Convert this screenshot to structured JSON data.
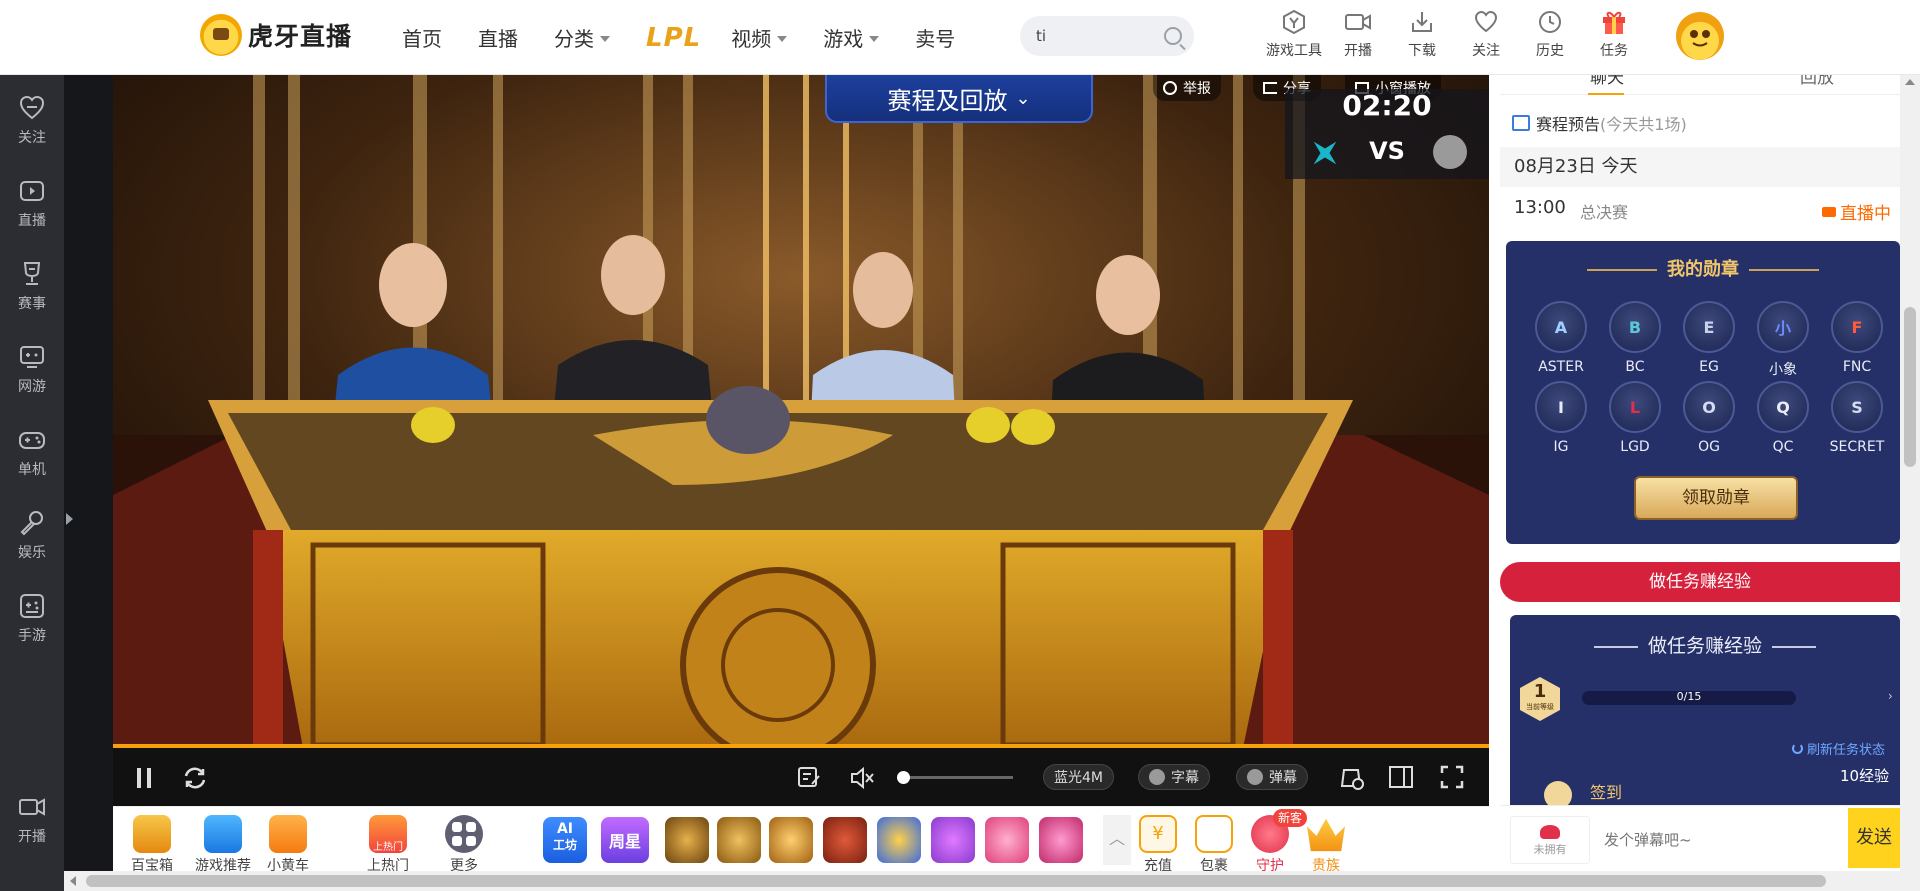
{
  "header": {
    "logo_text": "虎牙直播",
    "nav": [
      {
        "label": "首页",
        "caret": false
      },
      {
        "label": "直播",
        "caret": false
      },
      {
        "label": "分类",
        "caret": true
      },
      {
        "label": "LPL",
        "caret": false
      },
      {
        "label": "视频",
        "caret": true
      },
      {
        "label": "游戏",
        "caret": true
      },
      {
        "label": "卖号",
        "caret": false
      }
    ],
    "search": {
      "value": "ti"
    },
    "tools": [
      "游戏工具",
      "开播",
      "下载",
      "关注",
      "历史",
      "任务"
    ]
  },
  "sidebar": {
    "items": [
      "关注",
      "直播",
      "赛事",
      "网游",
      "单机",
      "娱乐",
      "手游"
    ],
    "bottom": "开播"
  },
  "video_overlay": {
    "schedule_button": "赛程及回放",
    "report": "举报",
    "share": "分享",
    "mini_player": "小窗播放",
    "timer": "02:20",
    "vs": "VS"
  },
  "controls": {
    "quality": "蓝光4M",
    "subtitle": "字幕",
    "danmaku": "弹幕",
    "progress": 1.0,
    "volume": 0.0
  },
  "gift_bar": {
    "left": [
      "百宝箱",
      "游戏推荐",
      "小黄车",
      "上热门",
      "更多"
    ],
    "right": [
      "充值",
      "包裹",
      "守护",
      "贵族"
    ],
    "new_badge": "新客",
    "hot_badge": "上热门",
    "week_star": "周星",
    "ai": "AI",
    "ai_sub": "工坊"
  },
  "right_panel": {
    "tabs": [
      "聊天",
      "回放"
    ],
    "schedule_title": "赛程预告",
    "schedule_count": "(今天共1场)",
    "date_line": "08月23日 今天",
    "match": {
      "time": "13:00",
      "name": "总决赛",
      "status": "直播中"
    },
    "medal_title": "我的勋章",
    "medals": [
      "ASTER",
      "BC",
      "EG",
      "小象",
      "FNC",
      "IG",
      "LGD",
      "OG",
      "QC",
      "SECRET"
    ],
    "claim_button": "领取勋章",
    "task_button": "做任务赚经验",
    "task_title": "做任务赚经验",
    "level": "1",
    "level_caption": "当前等级",
    "progress_text": "0/15",
    "progress": 0.0,
    "refresh": "刷新任务状态",
    "sign_in": "签到",
    "exp": "10经验",
    "chat_placeholder": "发个弹幕吧~",
    "chat_avatar_label": "未拥有",
    "send_button": "发送"
  },
  "colors": {
    "accent": "#f7a20b",
    "live_orange": "#ff6a00",
    "task_red": "#d5213c",
    "medal_bg": "#263068"
  }
}
